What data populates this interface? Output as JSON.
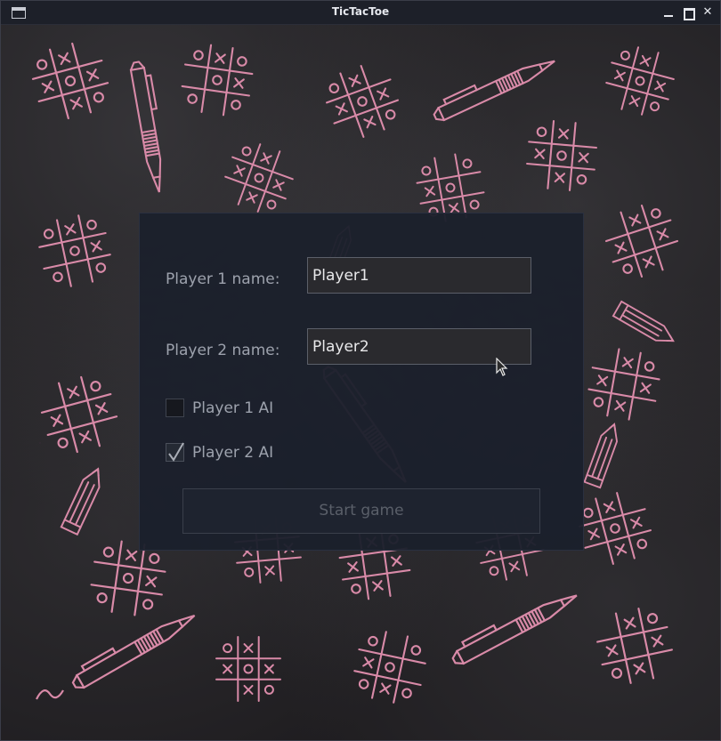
{
  "window": {
    "title": "TicTacToe"
  },
  "form": {
    "player1_label": "Player 1 name:",
    "player1_value": "Player1",
    "player2_label": "Player 2 name:",
    "player2_value": "Player2",
    "player1_ai_label": "Player 1 AI",
    "player1_ai_checked": false,
    "player2_ai_label": "Player 2 AI",
    "player2_ai_checked": true,
    "start_label": "Start game",
    "start_enabled": false
  },
  "colors": {
    "chalk": "#d98aa8",
    "dialog_bg": "#1b202c",
    "label_text": "#9da2ad"
  }
}
